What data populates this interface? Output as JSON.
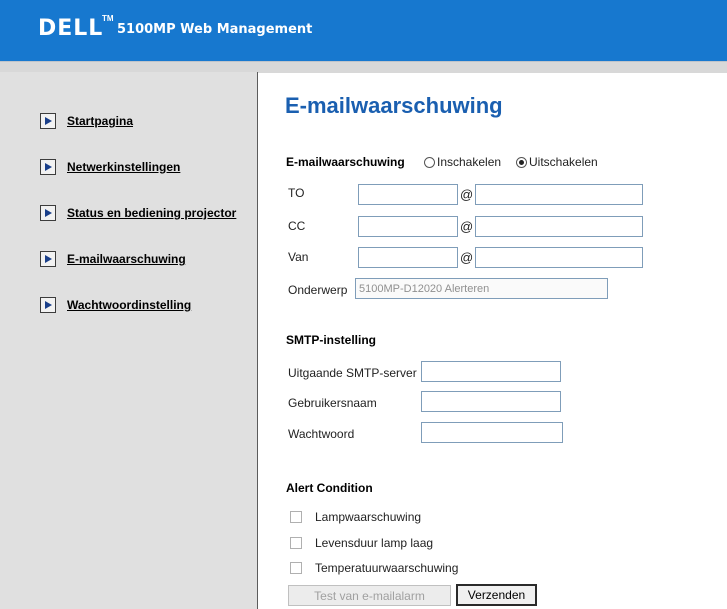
{
  "header": {
    "brand": "DELL",
    "trademark": "TM",
    "title": "5100MP Web Management",
    "bg_color": "#1778cf"
  },
  "sidebar": {
    "items": [
      {
        "label": "Startpagina"
      },
      {
        "label": "Netwerkinstellingen"
      },
      {
        "label": "Status en bediening projector"
      },
      {
        "label": "E-mailwaarschuwing"
      },
      {
        "label": "Wachtwoordinstelling"
      }
    ]
  },
  "main": {
    "title": "E-mailwaarschuwing",
    "email_alert": {
      "label": "E-mailwaarschuwing",
      "options": [
        "Inschakelen",
        "Uitschakelen"
      ],
      "selected": "Uitschakelen"
    },
    "fields": {
      "to_label": "TO",
      "cc_label": "CC",
      "from_label": "Van",
      "at_symbol": "@",
      "subject_label": "Onderwerp",
      "subject_value": "5100MP-D12020 Alerteren"
    },
    "smtp": {
      "heading": "SMTP-instelling",
      "server_label": "Uitgaande SMTP-server",
      "user_label": "Gebruikersnaam",
      "password_label": "Wachtwoord"
    },
    "alert_condition": {
      "heading": "Alert Condition",
      "items": [
        "Lampwaarschuwing",
        "Levensduur lamp laag",
        "Temperatuurwaarschuwing"
      ]
    },
    "buttons": {
      "test": "Test van e-mailalarm",
      "send": "Verzenden"
    }
  }
}
